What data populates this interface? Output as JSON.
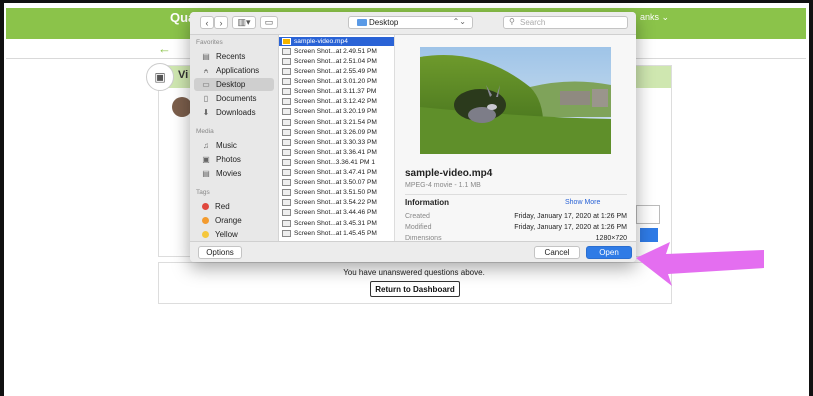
{
  "app": {
    "title": "Qual",
    "right_text": "anks ⌄",
    "card_label": "Vi",
    "unanswered": "You have unanswered questions above.",
    "return_button": "Return to Dashboard"
  },
  "dialog": {
    "toolbar": {
      "back": "‹",
      "forward": "›",
      "view": "▥▾",
      "new_folder": "▭",
      "location": "Desktop",
      "search_placeholder": "Search"
    },
    "sidebar": {
      "favorites_header": "Favorites",
      "favorites": [
        {
          "label": "Recents",
          "icon": "recents-icon"
        },
        {
          "label": "Applications",
          "icon": "applications-icon"
        },
        {
          "label": "Desktop",
          "icon": "desktop-icon"
        },
        {
          "label": "Documents",
          "icon": "documents-icon"
        },
        {
          "label": "Downloads",
          "icon": "downloads-icon"
        }
      ],
      "media_header": "Media",
      "media": [
        {
          "label": "Music",
          "icon": "music-icon"
        },
        {
          "label": "Photos",
          "icon": "photos-icon"
        },
        {
          "label": "Movies",
          "icon": "movies-icon"
        }
      ],
      "tags_header": "Tags",
      "tags": [
        {
          "label": "Red",
          "color": "#e0483e"
        },
        {
          "label": "Orange",
          "color": "#f39b2e"
        },
        {
          "label": "Yellow",
          "color": "#f5c73c"
        }
      ]
    },
    "files": [
      "sample-video.mp4",
      "Screen Shot...at 2.49.51 PM",
      "Screen Shot...at 2.51.04 PM",
      "Screen Shot...at 2.55.49 PM",
      "Screen Shot...at 3.01.20 PM",
      "Screen Shot...at 3.11.37 PM",
      "Screen Shot...at 3.12.42 PM",
      "Screen Shot...at 3.20.19 PM",
      "Screen Shot...at 3.21.54 PM",
      "Screen Shot...at 3.26.09 PM",
      "Screen Shot...at 3.30.33 PM",
      "Screen Shot...at 3.36.41 PM",
      "Screen Shot...3.36.41 PM 1",
      "Screen Shot...at 3.47.41 PM",
      "Screen Shot...at 3.50.07 PM",
      "Screen Shot...at 3.51.50 PM",
      "Screen Shot...at 3.54.22 PM",
      "Screen Shot...at 3.44.46 PM",
      "Screen Shot...at 3.45.31 PM",
      "Screen Shot...at 1.45.45 PM"
    ],
    "preview": {
      "name": "sample-video.mp4",
      "kind": "MPEG-4 movie - 1.1 MB",
      "info_header": "Information",
      "show_more": "Show More",
      "created_label": "Created",
      "created_value": "Friday, January 17, 2020 at 1:26 PM",
      "modified_label": "Modified",
      "modified_value": "Friday, January 17, 2020 at 1:26 PM",
      "dimensions_label": "Dimensions",
      "dimensions_value": "1280×720"
    },
    "options_button": "Options",
    "cancel_button": "Cancel",
    "open_button": "Open"
  },
  "colors": {
    "accent_green": "#8bc34a",
    "selection_blue": "#2a63d6",
    "arrow_pink": "#e46ef0"
  }
}
